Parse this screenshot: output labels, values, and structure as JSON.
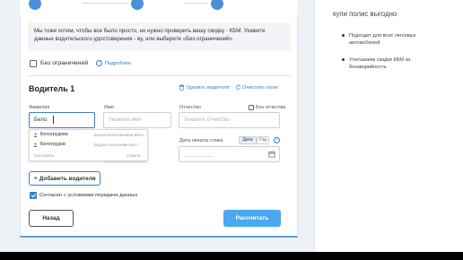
{
  "progress": {
    "steps": [
      "",
      "",
      ""
    ]
  },
  "info_text": "Мы тоже хотим, чтобы все было просто, но нужно проверить вашу скидку - КБМ. Укажите данные водительского удостоверения - ву, или выберите «Без ограничений»",
  "unlimited": {
    "label": "Без ограничений",
    "more_link": "Подробнее",
    "hint": "?"
  },
  "driver": {
    "title": "Водитель 1",
    "delete_label": "Удалить водителя",
    "clear_label": "Очистить поля",
    "surname_label": "Фамилия",
    "surname_value": "Бело",
    "name_label": "Имя",
    "name_placeholder": "Укажите имя",
    "patronymic_label": "Отчество",
    "patronymic_placeholder": "Укажите отчество",
    "no_patronymic_label": "Без отчества",
    "experience_label": "Дата начала стажа",
    "toggle_date": "Дата",
    "toggle_year": "Год",
    "date_placeholder": "__.__.____"
  },
  "autocomplete": {
    "items": [
      {
        "name": "Белогрудова",
        "hint": "Елена Валентиновна Бело..."
      },
      {
        "name": "Белогрудов",
        "hint": "Вадим Алексеевич Бел..."
      }
    ],
    "configure": "Настроить",
    "hide": "Скрыть"
  },
  "add_driver_label": "Добавить водителя",
  "consent_label": "Согласен с условиями передачи данных",
  "back_label": "Назад",
  "calc_label": "Рассчитать",
  "side": {
    "title": "купи полис выгодно",
    "items": [
      "Подходит для всех легковых автомобилей",
      "Учитываем скидки КБМ за безаварийность"
    ]
  },
  "colors": {
    "accent": "#3a7fcb",
    "button": "#4aa8ee"
  }
}
